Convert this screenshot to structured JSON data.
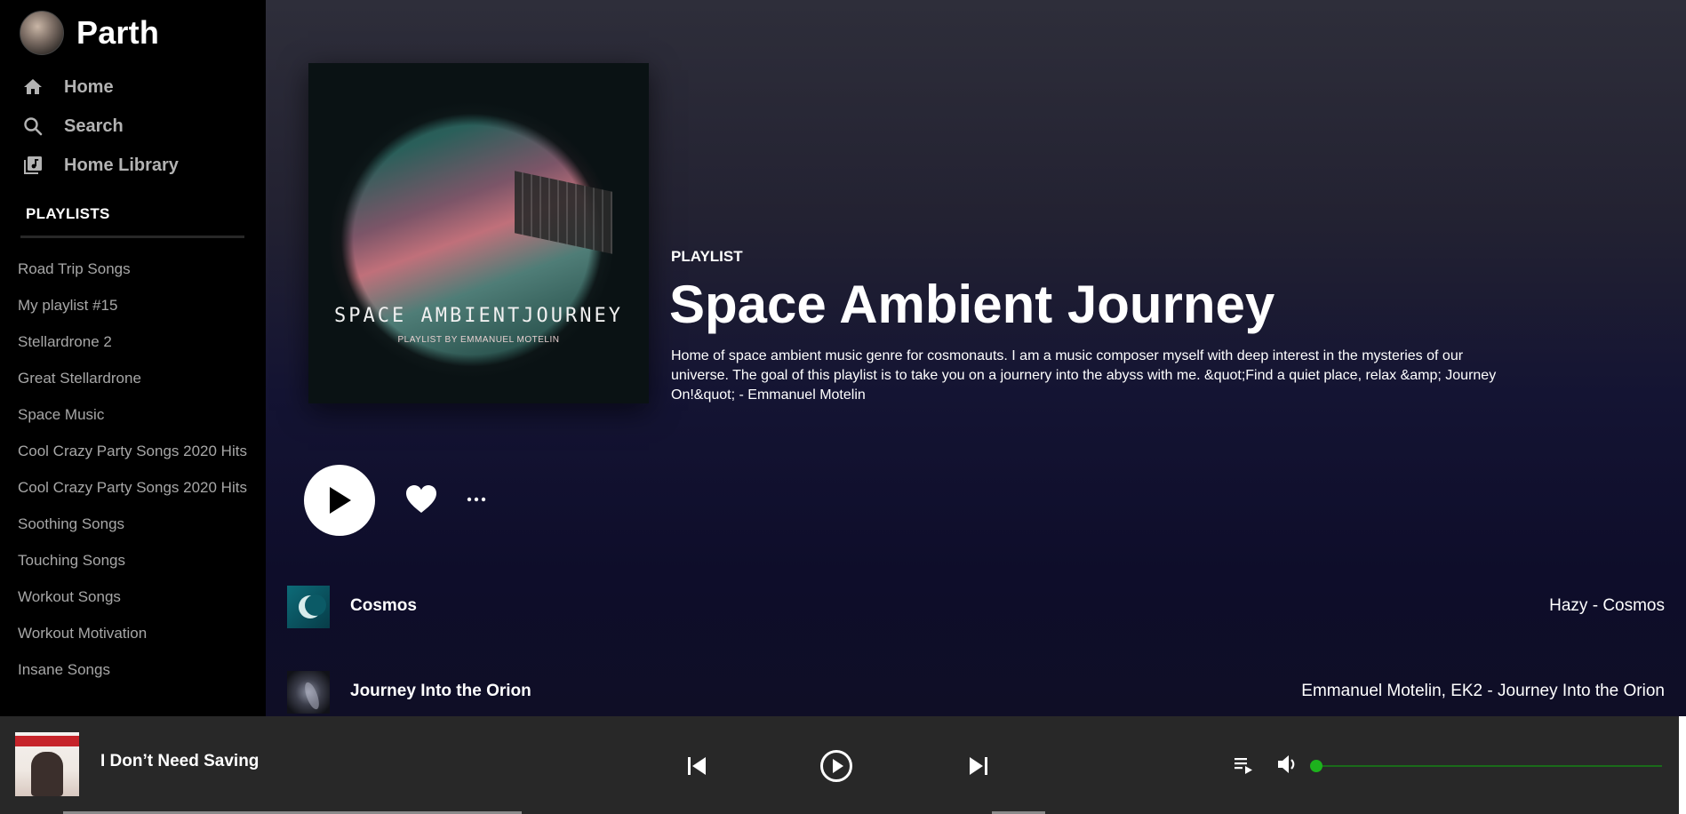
{
  "user": {
    "name": "Parth"
  },
  "nav": [
    {
      "label": "Home",
      "icon": "home-icon"
    },
    {
      "label": "Search",
      "icon": "search-icon"
    },
    {
      "label": "Home Library",
      "icon": "library-icon"
    }
  ],
  "sidebar": {
    "playlists_header": "PLAYLISTS",
    "playlists": [
      "Road Trip Songs",
      "My playlist #15",
      "Stellardrone 2",
      "Great Stellardrone",
      "Space Music",
      "Cool Crazy Party Songs 2020 Hits",
      "Cool Crazy Party Songs 2020 Hits",
      "Soothing Songs",
      "Touching Songs",
      "Workout Songs",
      "Workout Motivation",
      "Insane Songs"
    ]
  },
  "playlist": {
    "type_label": "PLAYLIST",
    "title": "Space Ambient Journey",
    "description": "Home of space ambient music genre for cosmonauts. I am a music composer myself with deep interest in the mysteries of our universe. The goal of this playlist is to take you on a journery into the abyss with me. &quot;Find a quiet place, relax &amp; Journey On!&quot; - Emmanuel Motelin",
    "cover_title": "SPACE AMBIENTJOURNEY",
    "cover_subtitle": "PLAYLIST BY EMMANUEL MOTELIN"
  },
  "tracks": [
    {
      "name": "Cosmos",
      "artist": "Hazy - Cosmos"
    },
    {
      "name": "Journey Into the Orion",
      "artist": "Emmanuel Motelin, EK2 - Journey Into the Orion"
    }
  ],
  "player": {
    "now_playing": "I Don’t Need Saving",
    "volume_fraction": 0.0
  },
  "colors": {
    "sidebar_bg": "#000000",
    "player_bg": "#282828",
    "accent_green": "#1db21d",
    "muted_text": "#b3b3b3"
  }
}
